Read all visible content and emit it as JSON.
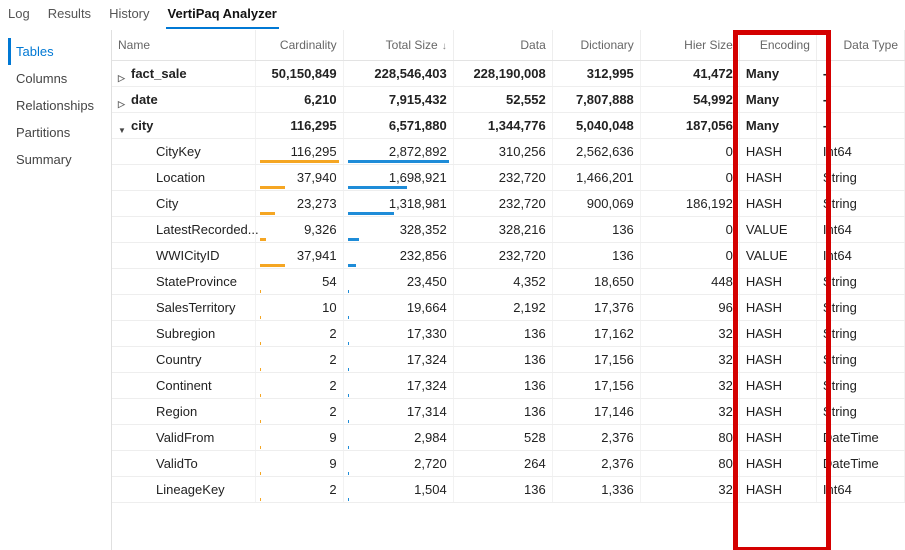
{
  "topTabs": {
    "log": "Log",
    "results": "Results",
    "history": "History",
    "vertipaq": "VertiPaq Analyzer"
  },
  "sidebar": {
    "items": [
      "Tables",
      "Columns",
      "Relationships",
      "Partitions",
      "Summary"
    ],
    "activeIndex": 0
  },
  "columns": {
    "name": "Name",
    "cardinality": "Cardinality",
    "totalSize": "Total Size",
    "data": "Data",
    "dictionary": "Dictionary",
    "hierSize": "Hier Size",
    "encoding": "Encoding",
    "dataType": "Data Type"
  },
  "cardMax": 116295,
  "totalMax": 2872892,
  "rows": [
    {
      "kind": "parent",
      "expand": "r",
      "name": "fact_sale",
      "card": "50,150,849",
      "total": "228,546,403",
      "data": "228,190,008",
      "dict": "312,995",
      "hier": "41,472",
      "enc": "Many",
      "type": "-",
      "cardN": null,
      "totalN": null
    },
    {
      "kind": "parent",
      "expand": "r",
      "name": "date",
      "card": "6,210",
      "total": "7,915,432",
      "data": "52,552",
      "dict": "7,807,888",
      "hier": "54,992",
      "enc": "Many",
      "type": "-",
      "cardN": null,
      "totalN": null
    },
    {
      "kind": "parent",
      "expand": "d",
      "name": "city",
      "card": "116,295",
      "total": "6,571,880",
      "data": "1,344,776",
      "dict": "5,040,048",
      "hier": "187,056",
      "enc": "Many",
      "type": "-",
      "cardN": null,
      "totalN": null
    },
    {
      "kind": "child",
      "name": "CityKey",
      "card": "116,295",
      "total": "2,872,892",
      "data": "310,256",
      "dict": "2,562,636",
      "hier": "0",
      "enc": "HASH",
      "type": "Int64",
      "cardN": 116295,
      "totalN": 2872892
    },
    {
      "kind": "child",
      "name": "Location",
      "card": "37,940",
      "total": "1,698,921",
      "data": "232,720",
      "dict": "1,466,201",
      "hier": "0",
      "enc": "HASH",
      "type": "String",
      "cardN": 37940,
      "totalN": 1698921
    },
    {
      "kind": "child",
      "name": "City",
      "card": "23,273",
      "total": "1,318,981",
      "data": "232,720",
      "dict": "900,069",
      "hier": "186,192",
      "enc": "HASH",
      "type": "String",
      "cardN": 23273,
      "totalN": 1318981
    },
    {
      "kind": "child",
      "name": "LatestRecorded...",
      "card": "9,326",
      "total": "328,352",
      "data": "328,216",
      "dict": "136",
      "hier": "0",
      "enc": "VALUE",
      "type": "Int64",
      "cardN": 9326,
      "totalN": 328352
    },
    {
      "kind": "child",
      "name": "WWICityID",
      "card": "37,941",
      "total": "232,856",
      "data": "232,720",
      "dict": "136",
      "hier": "0",
      "enc": "VALUE",
      "type": "Int64",
      "cardN": 37941,
      "totalN": 232856
    },
    {
      "kind": "child",
      "name": "StateProvince",
      "card": "54",
      "total": "23,450",
      "data": "4,352",
      "dict": "18,650",
      "hier": "448",
      "enc": "HASH",
      "type": "String",
      "cardN": 54,
      "totalN": 23450
    },
    {
      "kind": "child",
      "name": "SalesTerritory",
      "card": "10",
      "total": "19,664",
      "data": "2,192",
      "dict": "17,376",
      "hier": "96",
      "enc": "HASH",
      "type": "String",
      "cardN": 10,
      "totalN": 19664
    },
    {
      "kind": "child",
      "name": "Subregion",
      "card": "2",
      "total": "17,330",
      "data": "136",
      "dict": "17,162",
      "hier": "32",
      "enc": "HASH",
      "type": "String",
      "cardN": 2,
      "totalN": 17330
    },
    {
      "kind": "child",
      "name": "Country",
      "card": "2",
      "total": "17,324",
      "data": "136",
      "dict": "17,156",
      "hier": "32",
      "enc": "HASH",
      "type": "String",
      "cardN": 2,
      "totalN": 17324
    },
    {
      "kind": "child",
      "name": "Continent",
      "card": "2",
      "total": "17,324",
      "data": "136",
      "dict": "17,156",
      "hier": "32",
      "enc": "HASH",
      "type": "String",
      "cardN": 2,
      "totalN": 17324
    },
    {
      "kind": "child",
      "name": "Region",
      "card": "2",
      "total": "17,314",
      "data": "136",
      "dict": "17,146",
      "hier": "32",
      "enc": "HASH",
      "type": "String",
      "cardN": 2,
      "totalN": 17314
    },
    {
      "kind": "child",
      "name": "ValidFrom",
      "card": "9",
      "total": "2,984",
      "data": "528",
      "dict": "2,376",
      "hier": "80",
      "enc": "HASH",
      "type": "DateTime",
      "cardN": 9,
      "totalN": 2984
    },
    {
      "kind": "child",
      "name": "ValidTo",
      "card": "9",
      "total": "2,720",
      "data": "264",
      "dict": "2,376",
      "hier": "80",
      "enc": "HASH",
      "type": "DateTime",
      "cardN": 9,
      "totalN": 2720
    },
    {
      "kind": "child",
      "name": "LineageKey",
      "card": "2",
      "total": "1,504",
      "data": "136",
      "dict": "1,336",
      "hier": "32",
      "enc": "HASH",
      "type": "Int64",
      "cardN": 2,
      "totalN": 1504
    }
  ]
}
